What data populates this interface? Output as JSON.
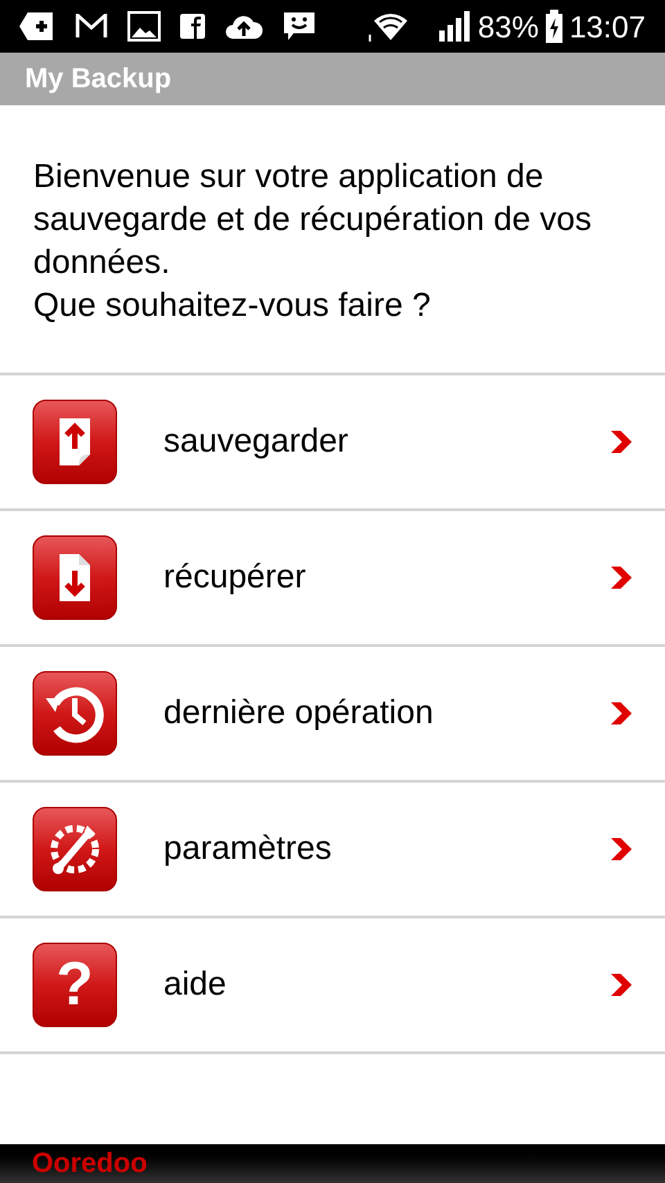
{
  "status_bar": {
    "battery": "83%",
    "time": "13:07"
  },
  "app_bar": {
    "title": "My Backup"
  },
  "intro": [
    "Bienvenue sur votre application de sauvegarde et de récupération de vos données.",
    "Que souhaitez-vous faire ?"
  ],
  "menu": [
    {
      "kind": "upload",
      "label": "sauvegarder"
    },
    {
      "kind": "download",
      "label": "récupérer"
    },
    {
      "kind": "history",
      "label": "dernière opération"
    },
    {
      "kind": "settings",
      "label": "paramètres"
    },
    {
      "kind": "help",
      "label": "aide",
      "glyph": "?"
    }
  ],
  "carrier": "Ooredoo"
}
